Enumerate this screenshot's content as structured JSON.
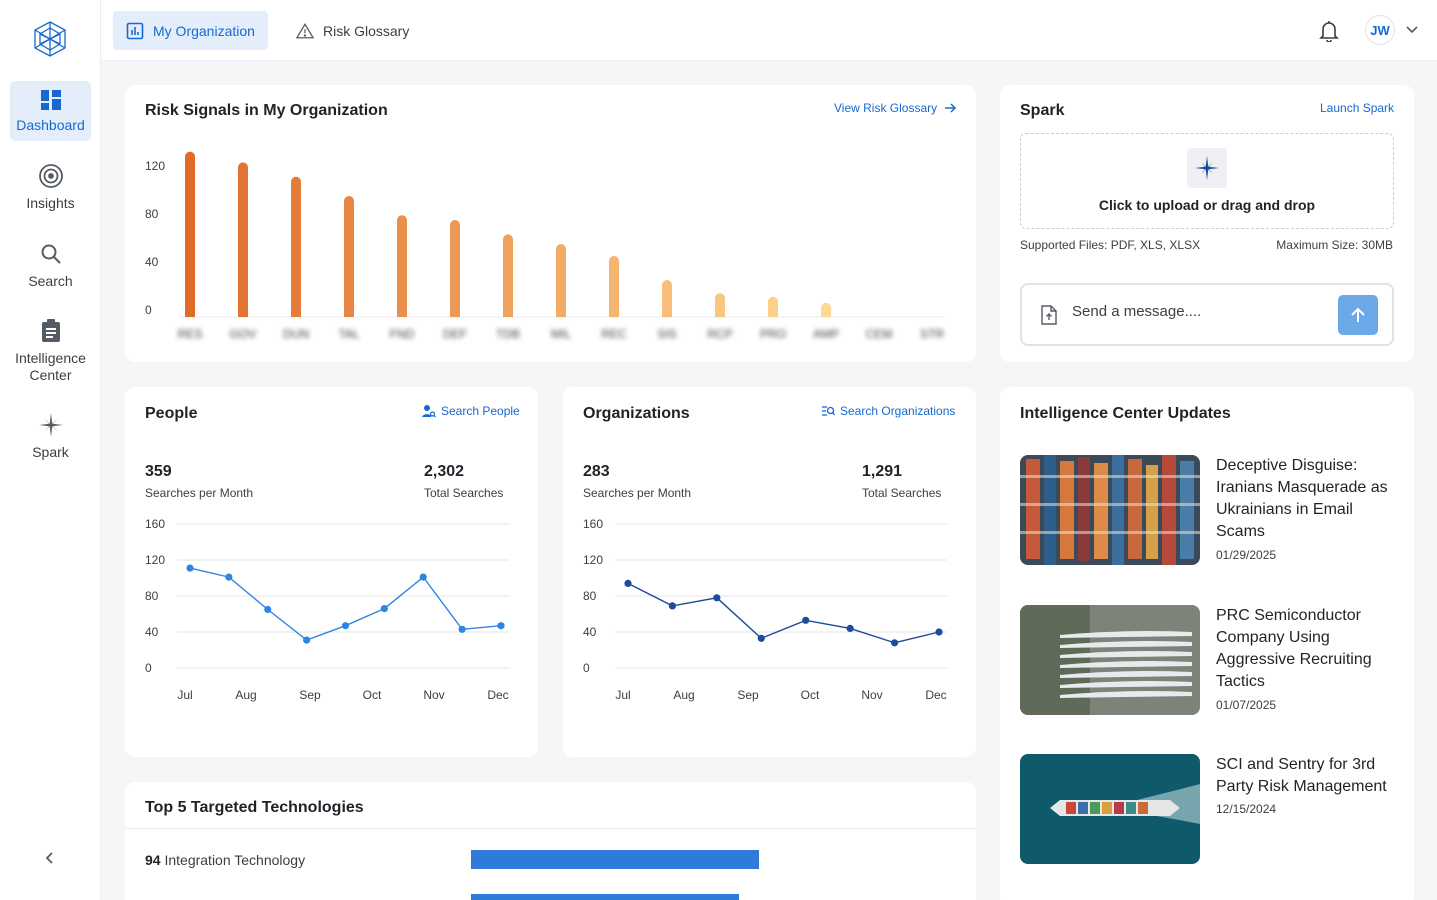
{
  "sidebar": {
    "items": [
      {
        "label": "Dashboard",
        "icon": "dashboard-icon"
      },
      {
        "label": "Insights",
        "icon": "target-icon"
      },
      {
        "label": "Search",
        "icon": "search-icon"
      },
      {
        "label": "Intelligence Center",
        "icon": "clipboard-icon"
      },
      {
        "label": "Spark",
        "icon": "sparkle-icon"
      }
    ]
  },
  "header": {
    "tabs": [
      {
        "label": "My Organization",
        "icon": "bar-chart-icon"
      },
      {
        "label": "Risk Glossary",
        "icon": "warning-icon"
      }
    ],
    "user_initials": "JW"
  },
  "risk_signals": {
    "title": "Risk Signals in My Organization",
    "link": "View Risk Glossary"
  },
  "spark": {
    "title": "Spark",
    "link": "Launch Spark",
    "upload_text": "Click to upload or drag and drop",
    "supported": "Supported Files: PDF, XLS, XLSX",
    "max_size": "Maximum Size: 30MB",
    "message_placeholder": "Send a message...."
  },
  "people": {
    "title": "People",
    "link": "Search People",
    "monthly_value": "359",
    "monthly_label": "Searches per Month",
    "total_value": "2,302",
    "total_label": "Total Searches"
  },
  "organizations": {
    "title": "Organizations",
    "link": "Search Organizations",
    "monthly_value": "283",
    "monthly_label": "Searches per Month",
    "total_value": "1,291",
    "total_label": "Total Searches"
  },
  "updates": {
    "title": "Intelligence Center Updates",
    "items": [
      {
        "title": "Deceptive Disguise: Iranians Masquerade as Ukrainians in Email Scams",
        "date": "01/29/2025"
      },
      {
        "title": "PRC Semiconductor Company Using Aggressive Recruiting Tactics",
        "date": "01/07/2025"
      },
      {
        "title": "SCI and Sentry for 3rd Party Risk Management",
        "date": "12/15/2024"
      }
    ]
  },
  "technologies": {
    "title": "Top 5 Targeted Technologies",
    "items": [
      {
        "count": "94",
        "label": "Integration Technology",
        "value": 94
      }
    ]
  },
  "colors": {
    "accent": "#1769d1",
    "bar_light": "#fdd08a",
    "bar_dark": "#e06a28",
    "people_line": "#2e86de",
    "org_line": "#1e4a9c"
  },
  "chart_data": [
    {
      "type": "bar",
      "categories": [
        "RES",
        "GOV",
        "DUN",
        "TAL",
        "FND",
        "DEF",
        "TDB",
        "MIL",
        "REC",
        "SIS",
        "RCP",
        "PRO",
        "AMP",
        "CEM",
        "STR"
      ],
      "values": [
        132,
        123,
        111,
        95,
        79,
        75,
        63,
        55,
        45,
        25,
        14,
        11,
        6,
        0,
        0
      ],
      "title": "Risk Signals in My Organization",
      "yticks": [
        0,
        40,
        80,
        120
      ],
      "ylim": [
        0,
        135
      ],
      "grid": false
    },
    {
      "type": "line",
      "title": "People",
      "x": [
        "Jul",
        "Aug",
        "Sep",
        "Oct",
        "Nov",
        "Dec"
      ],
      "x_positions": [
        0,
        0.75,
        1.4,
        2.1,
        2.55,
        3.05,
        3.65,
        4.15,
        4.6,
        5.2
      ],
      "values": [
        111,
        101,
        65,
        31,
        47,
        66,
        101,
        43,
        47
      ],
      "yticks": [
        0,
        40,
        80,
        120,
        160
      ],
      "ylim": [
        0,
        160
      ],
      "grid": true
    },
    {
      "type": "line",
      "title": "Organizations",
      "x": [
        "Jul",
        "Aug",
        "Sep",
        "Oct",
        "Nov",
        "Dec"
      ],
      "values": [
        94,
        69,
        78,
        33,
        53,
        44,
        28,
        40
      ],
      "yticks": [
        0,
        40,
        80,
        120,
        160
      ],
      "ylim": [
        0,
        160
      ],
      "grid": true
    }
  ]
}
